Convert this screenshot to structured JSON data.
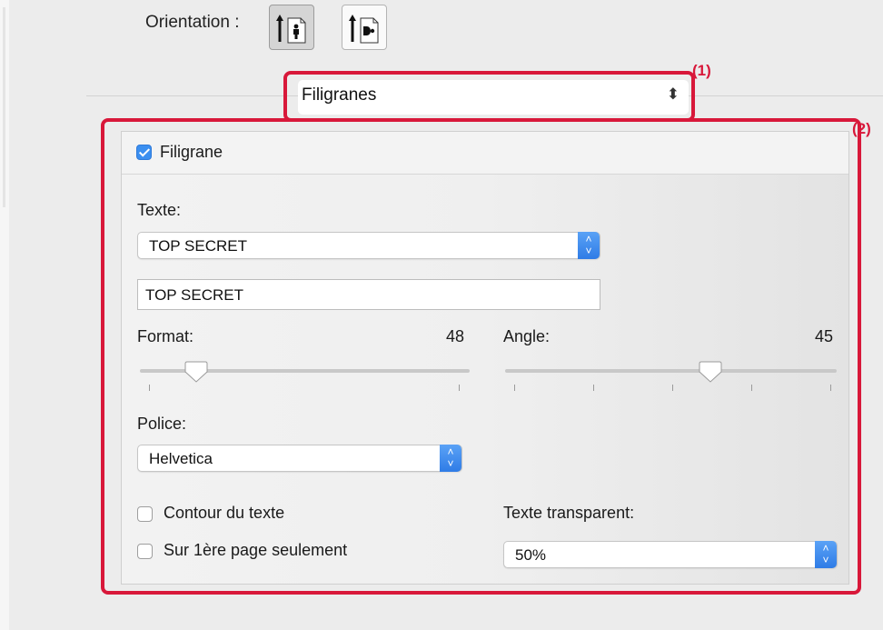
{
  "orientation": {
    "label": "Orientation :",
    "options": [
      "portrait-icon",
      "landscape-icon"
    ]
  },
  "annotations": [
    "(1)",
    "(2)"
  ],
  "panel_selector": {
    "value": "Filigranes",
    "icon": "up-down-chevron-icon"
  },
  "watermark": {
    "enabled": true,
    "checkbox_label": "Filigrane",
    "text_label": "Texte:",
    "text_preset": "TOP SECRET",
    "text_value": "TOP SECRET",
    "format_label": "Format:",
    "format_value": "48",
    "format_fraction": 0.17,
    "angle_label": "Angle:",
    "angle_value": "45",
    "angle_fraction": 0.62,
    "font_label": "Police:",
    "font_value": "Helvetica",
    "outline": {
      "label": "Contour du texte",
      "checked": false
    },
    "first_page_only": {
      "label": "Sur 1ère page seulement",
      "checked": false
    },
    "transparency_label": "Texte transparent:",
    "transparency_value": "50%"
  },
  "colors": {
    "accent": "#3b8ff0",
    "annotation": "#d8183a"
  }
}
